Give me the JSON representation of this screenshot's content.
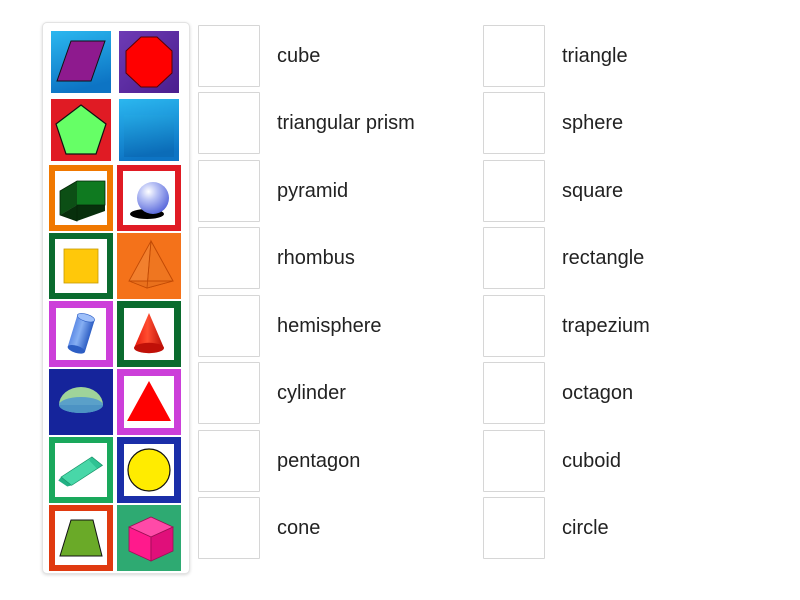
{
  "activity": {
    "type": "match-up-drag-and-drop",
    "title": "Shapes match up"
  },
  "image_panel": {
    "name": "shape-image-bank",
    "tiles": [
      {
        "id": "tile-1",
        "shape": "rhombus",
        "shape_label": "rhombus",
        "shape_color": "#8e1a8e",
        "background": "#1a9de0",
        "background_style": "gradient-blue",
        "border_color": "none"
      },
      {
        "id": "tile-2",
        "shape": "octagon",
        "shape_label": "octagon",
        "shape_color": "#ff0000",
        "background": "#5b2d9b",
        "background_style": "solid-purple",
        "border_color": "none"
      },
      {
        "id": "tile-3",
        "shape": "pentagon",
        "shape_label": "pentagon",
        "shape_color": "#66ff66",
        "background": "#e01b24",
        "background_style": "solid-red",
        "border_color": "none"
      },
      {
        "id": "tile-4",
        "shape": "square",
        "shape_label": "square",
        "shape_color": "#1184cf",
        "background": "#1a9de0",
        "background_style": "gradient-blue",
        "border_color": "none"
      },
      {
        "id": "tile-5",
        "shape": "cuboid",
        "shape_label": "cuboid",
        "shape_color": "#0b5c16",
        "background": "#ffffff",
        "background_style": "white",
        "border_color": "#f07800"
      },
      {
        "id": "tile-6",
        "shape": "sphere",
        "shape_label": "sphere",
        "shape_color": "#7a8cf0",
        "background": "#ffffff",
        "background_style": "white",
        "border_color": "#e01b24"
      },
      {
        "id": "tile-7",
        "shape": "square-yellow",
        "shape_label": "square",
        "shape_color": "#ffc80a",
        "background": "#ffffff",
        "background_style": "white",
        "border_color": "#0a6b2e"
      },
      {
        "id": "tile-8",
        "shape": "pyramid",
        "shape_label": "pyramid",
        "shape_color": "#f26a14",
        "background": "#f4721a",
        "background_style": "solid-orange",
        "border_color": "none"
      },
      {
        "id": "tile-9",
        "shape": "cylinder",
        "shape_label": "cylinder",
        "shape_color": "#3f72d8",
        "background": "#ffffff",
        "background_style": "white",
        "border_color": "#cc3fd9"
      },
      {
        "id": "tile-10",
        "shape": "cone",
        "shape_label": "cone",
        "shape_color": "#e01b0f",
        "background": "#ffffff",
        "background_style": "white",
        "border_color": "#0a6b2e"
      },
      {
        "id": "tile-11",
        "shape": "hemisphere",
        "shape_label": "hemisphere",
        "shape_color": "#9fd49a",
        "background": "#15249b",
        "background_style": "solid-navy",
        "border_color": "none"
      },
      {
        "id": "tile-12",
        "shape": "triangle",
        "shape_label": "triangle",
        "shape_color": "#ff0000",
        "background": "#ffffff",
        "background_style": "white",
        "border_color": "#cc3fd9"
      },
      {
        "id": "tile-13",
        "shape": "triangular-prism",
        "shape_label": "triangular prism",
        "shape_color": "#3fcc9b",
        "background": "#ffffff",
        "background_style": "white",
        "border_color": "#1aa85c"
      },
      {
        "id": "tile-14",
        "shape": "circle",
        "shape_label": "circle",
        "shape_color": "#ffec00",
        "background": "#ffffff",
        "background_style": "white",
        "border_color": "#1a2ea8"
      },
      {
        "id": "tile-15",
        "shape": "trapezium",
        "shape_label": "trapezium",
        "shape_color": "#6aaa28",
        "background": "#ffffff",
        "background_style": "white",
        "border_color": "#e03a10"
      },
      {
        "id": "tile-16",
        "shape": "cube",
        "shape_label": "cube",
        "shape_color": "#ff1a8c",
        "background": "#2eaa72",
        "background_style": "solid-green",
        "border_color": "none"
      }
    ]
  },
  "answers": {
    "column_1": [
      {
        "label": "cube",
        "drop_value": ""
      },
      {
        "label": "triangular prism",
        "drop_value": ""
      },
      {
        "label": "pyramid",
        "drop_value": ""
      },
      {
        "label": "rhombus",
        "drop_value": ""
      },
      {
        "label": "hemisphere",
        "drop_value": ""
      },
      {
        "label": "cylinder",
        "drop_value": ""
      },
      {
        "label": "pentagon",
        "drop_value": ""
      },
      {
        "label": "cone",
        "drop_value": ""
      }
    ],
    "column_2": [
      {
        "label": "triangle",
        "drop_value": ""
      },
      {
        "label": "sphere",
        "drop_value": ""
      },
      {
        "label": "square",
        "drop_value": ""
      },
      {
        "label": "rectangle",
        "drop_value": ""
      },
      {
        "label": "trapezium",
        "drop_value": ""
      },
      {
        "label": "octagon",
        "drop_value": ""
      },
      {
        "label": "cuboid",
        "drop_value": ""
      },
      {
        "label": "circle",
        "drop_value": ""
      }
    ]
  },
  "colors": {
    "page_background": "#ffffff",
    "panel_border": "#e3e3e3",
    "drop_box_border": "#d6d6d6",
    "label_text": "#222222"
  }
}
